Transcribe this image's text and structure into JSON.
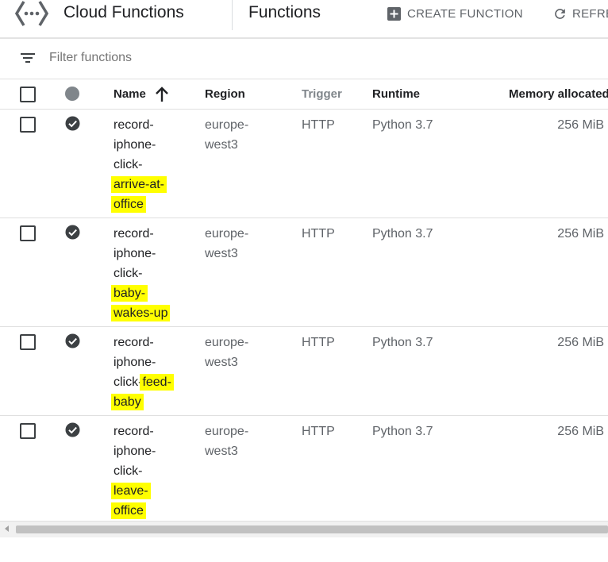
{
  "header": {
    "product_title": "Cloud Functions",
    "page_title": "Functions",
    "create_label": "CREATE FUNCTION",
    "refresh_label": "REFRE"
  },
  "filter": {
    "placeholder": "Filter functions",
    "icon": "filter-list-icon"
  },
  "table": {
    "columns": {
      "name": "Name",
      "region": "Region",
      "trigger": "Trigger",
      "runtime": "Runtime",
      "memory": "Memory allocated"
    },
    "sort": {
      "column": "Name",
      "direction": "ascending",
      "icon": "arrow-up-icon"
    },
    "rows": [
      {
        "name_lines": [
          "record-",
          "iphone-",
          "click-"
        ],
        "name_highlight_lines": [
          "arrive-at-",
          "office"
        ],
        "region_lines": [
          "europe-",
          "west3"
        ],
        "trigger": "HTTP",
        "runtime": "Python 3.7",
        "memory": "256 MiB",
        "status_icon": "check-circle-icon"
      },
      {
        "name_lines": [
          "record-",
          "iphone-",
          "click-"
        ],
        "name_highlight_lines": [
          "baby-",
          "wakes-up"
        ],
        "region_lines": [
          "europe-",
          "west3"
        ],
        "trigger": "HTTP",
        "runtime": "Python 3.7",
        "memory": "256 MiB",
        "status_icon": "check-circle-icon"
      },
      {
        "name_lines": [
          "record-",
          "iphone-",
          "click-"
        ],
        "name_highlight_lines": [
          "feed-",
          "baby"
        ],
        "region_lines": [
          "europe-",
          "west3"
        ],
        "trigger": "HTTP",
        "runtime": "Python 3.7",
        "memory": "256 MiB",
        "status_icon": "check-circle-icon"
      },
      {
        "name_lines": [
          "record-",
          "iphone-",
          "click-"
        ],
        "name_highlight_lines": [
          "leave-",
          "office"
        ],
        "region_lines": [
          "europe-",
          "west3"
        ],
        "trigger": "HTTP",
        "runtime": "Python 3.7",
        "memory": "256 MiB",
        "status_icon": "check-circle-icon"
      }
    ]
  },
  "colors": {
    "highlight": "#ffff00",
    "text_primary": "#202124",
    "text_secondary": "#5f6368",
    "status_ok": "#3c4043"
  }
}
